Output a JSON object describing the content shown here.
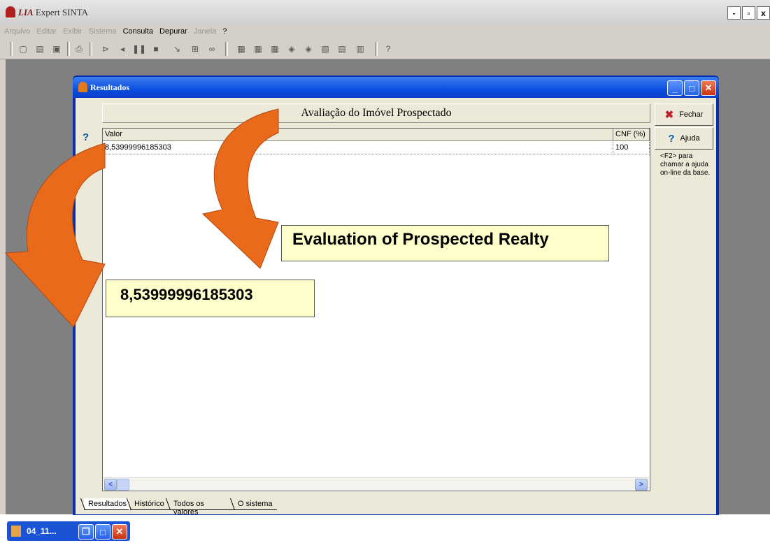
{
  "app": {
    "title_brand": "LIA",
    "title_rest": " Expert SINTA",
    "controls": [
      "-",
      "▫",
      "x"
    ]
  },
  "menu": {
    "items": [
      {
        "label": "Arquivo",
        "enabled": false
      },
      {
        "label": "Editar",
        "enabled": false
      },
      {
        "label": "Exibir",
        "enabled": false
      },
      {
        "label": "Sistema",
        "enabled": false
      },
      {
        "label": "Consulta",
        "enabled": true
      },
      {
        "label": "Depurar",
        "enabled": true
      },
      {
        "label": "Janela",
        "enabled": false
      },
      {
        "label": "?",
        "enabled": true
      }
    ]
  },
  "results_window": {
    "title": "Resultados",
    "heading": "Avaliação do Imóvel Prospectado",
    "columns": [
      "Valor",
      "CNF (%)"
    ],
    "rows": [
      {
        "valor": "8,53999996185303",
        "cnf": "100"
      }
    ],
    "buttons": {
      "close": "Fechar",
      "help": "Ajuda"
    },
    "help_note": "<F2> para chamar a ajuda on-line da base.",
    "tabs": [
      "Resultados",
      "Histórico",
      "Todos os valores",
      "O sistema"
    ],
    "active_tab": "Resultados"
  },
  "annotations": {
    "title_callout": "Evaluation of Prospected Realty",
    "value_callout": "8,53999996185303"
  },
  "taskbar": {
    "task_label": "04_11..."
  },
  "colors": {
    "xp_blue": "#0b4fe0",
    "arrow_orange": "#e86a1a",
    "callout_bg": "#ffffcc",
    "workspace_gray": "#808080"
  }
}
